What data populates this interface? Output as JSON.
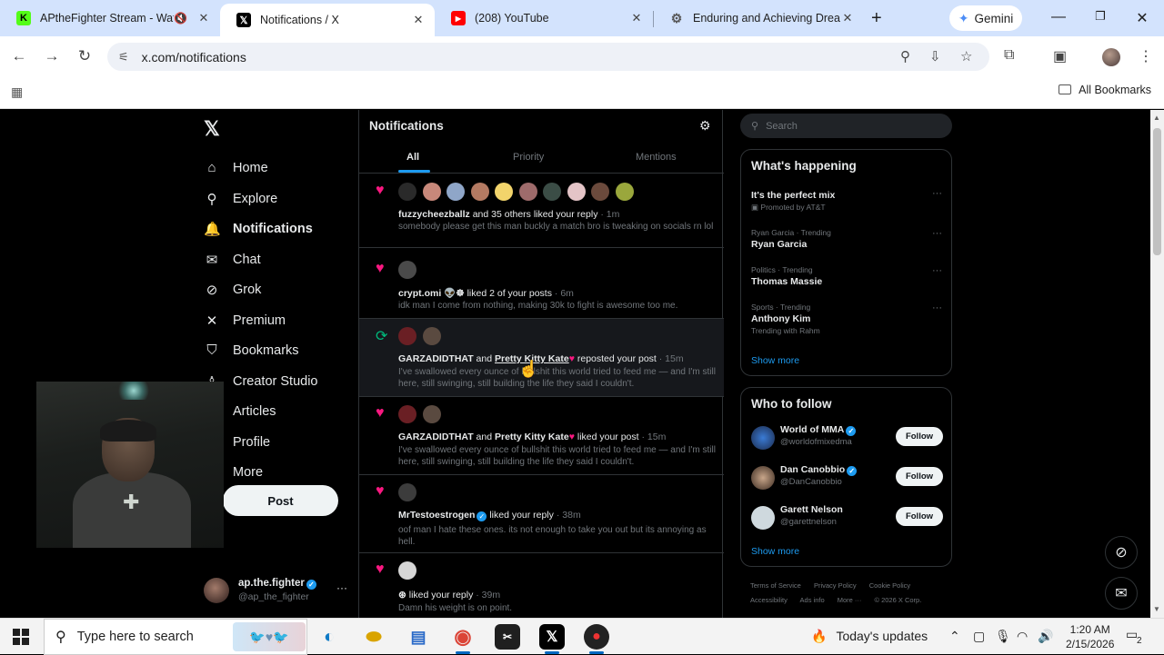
{
  "browser": {
    "tabs": [
      {
        "title": "APtheFighter Stream - Watc",
        "icon": "kick-icon",
        "color": "#53fc18"
      },
      {
        "title": "Notifications / X",
        "icon": "x-icon",
        "color": "#000000"
      },
      {
        "title": "(208) YouTube",
        "icon": "youtube-icon",
        "color": "#ff0000"
      },
      {
        "title": "Enduring and Achieving Dream",
        "icon": "chatgpt-icon",
        "color": "#555555"
      }
    ],
    "gemini_label": "Gemini",
    "url": "x.com/notifications",
    "all_bookmarks": "All Bookmarks"
  },
  "x": {
    "nav": [
      {
        "label": "Home",
        "icon": "home-icon",
        "glyph": "⌂"
      },
      {
        "label": "Explore",
        "icon": "search-icon",
        "glyph": "⚲"
      },
      {
        "label": "Notifications",
        "icon": "bell-icon",
        "glyph": "🔔"
      },
      {
        "label": "Chat",
        "icon": "mail-icon",
        "glyph": "✉"
      },
      {
        "label": "Grok",
        "icon": "grok-icon",
        "glyph": "⊘"
      },
      {
        "label": "Premium",
        "icon": "x-icon",
        "glyph": "✕"
      },
      {
        "label": "Bookmarks",
        "icon": "bookmark-icon",
        "glyph": "⛉"
      },
      {
        "label": "Creator Studio",
        "icon": "creator-icon",
        "glyph": "♙"
      },
      {
        "label": "Articles",
        "icon": "articles-icon",
        "glyph": "▤"
      },
      {
        "label": "Profile",
        "icon": "profile-icon",
        "glyph": "◯"
      },
      {
        "label": "More",
        "icon": "more-icon",
        "glyph": "⋯"
      }
    ],
    "post_button": "Post",
    "account": {
      "name": "ap.the.fighter",
      "handle": "@ap_the_fighter"
    },
    "notifications": {
      "title": "Notifications",
      "tabs": [
        "All",
        "Priority",
        "Mentions"
      ],
      "items": [
        {
          "type": "like",
          "actors": "fuzzycheezballz",
          "rest": " and 35 others liked your reply",
          "time": "· 1m",
          "text": "somebody please get this man buckly a match bro is tweaking on socials rn lol"
        },
        {
          "type": "like",
          "actors": "crypt.omi 👽☸",
          "rest": " liked 2 of your posts",
          "time": "· 6m",
          "text": "idk man I come from nothing, making 30k to fight is awesome too me."
        },
        {
          "type": "repost",
          "actors": "GARZADIDTHAT",
          "rest": " and ",
          "actor2": "Pretty Kitty Kate",
          "rest2": " reposted your post",
          "time": "· 15m",
          "text": "I've swallowed every ounce of bullshit this world tried to feed me — and I'm still here, still swinging, still building the life they said I couldn't."
        },
        {
          "type": "like",
          "actors": "GARZADIDTHAT",
          "rest": " and ",
          "actor2": "Pretty Kitty Kate",
          "rest2": " liked your post",
          "time": "· 15m",
          "text": "I've swallowed every ounce of bullshit this world tried to feed me — and I'm still here, still swinging, still building the life they said I couldn't."
        },
        {
          "type": "like",
          "actors": "MrTestoestrogen",
          "rest": " liked your reply",
          "time": "· 38m",
          "text": "oof man I hate these ones. its not enough to take you out but its annoying as hell."
        },
        {
          "type": "like",
          "actors": "⊛",
          "rest": " liked your reply",
          "time": "· 39m",
          "text": "Damn his weight is on point."
        }
      ]
    },
    "search_placeholder": "Search",
    "happening": {
      "title": "What's happening",
      "items": [
        {
          "context": "",
          "title": "It's the perfect mix",
          "sub": "Promoted by AT&T"
        },
        {
          "context": "Ryan Garcia · Trending",
          "title": "Ryan Garcia",
          "sub": ""
        },
        {
          "context": "Politics · Trending",
          "title": "Thomas Massie",
          "sub": ""
        },
        {
          "context": "Sports · Trending",
          "title": "Anthony Kim",
          "sub": "Trending with Rahm"
        }
      ],
      "show_more": "Show more"
    },
    "who_to_follow": {
      "title": "Who to follow",
      "items": [
        {
          "name": "World of MMA",
          "handle": "@worldofmixedma",
          "button": "Follow"
        },
        {
          "name": "Dan Canobbio",
          "handle": "@DanCanobbio",
          "button": "Follow"
        },
        {
          "name": "Garett Nelson",
          "handle": "@garettnelson",
          "button": "Follow"
        }
      ],
      "show_more": "Show more"
    },
    "footer": [
      "Terms of Service",
      "Privacy Policy",
      "Cookie Policy",
      "Accessibility",
      "Ads info",
      "More ···",
      "© 2026 X Corp."
    ]
  },
  "taskbar": {
    "search_placeholder": "Type here to search",
    "weather": "Today's updates",
    "time": "1:20 AM",
    "date": "2/15/2026",
    "notification_count": "2"
  }
}
